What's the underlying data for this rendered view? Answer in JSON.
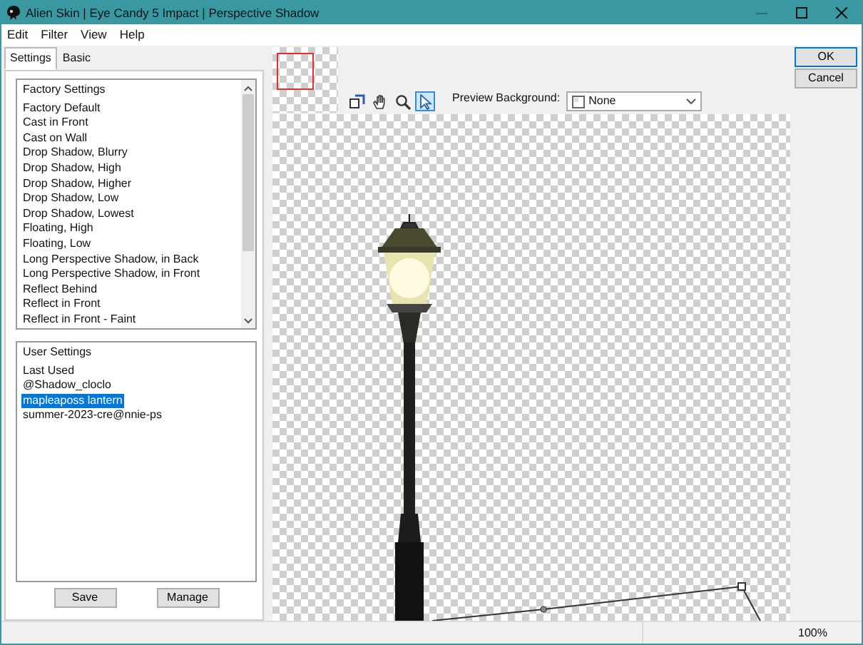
{
  "window": {
    "title": "Alien Skin | Eye Candy 5 Impact | Perspective Shadow"
  },
  "menu": [
    "Edit",
    "Filter",
    "View",
    "Help"
  ],
  "tabs": [
    {
      "label": "Settings",
      "selected": true
    },
    {
      "label": "Basic",
      "selected": false
    }
  ],
  "factory_settings": {
    "heading": "Factory Settings",
    "items": [
      "Factory Default",
      "Cast in Front",
      "Cast on Wall",
      "Drop Shadow, Blurry",
      "Drop Shadow, High",
      "Drop Shadow, Higher",
      "Drop Shadow, Low",
      "Drop Shadow, Lowest",
      "Floating, High",
      "Floating, Low",
      "Long Perspective Shadow, in Back",
      "Long Perspective Shadow, in Front",
      "Reflect Behind",
      "Reflect in Front",
      "Reflect in Front - Faint"
    ]
  },
  "user_settings": {
    "heading": "User Settings",
    "items": [
      {
        "label": "Last Used",
        "selected": false
      },
      {
        "label": "@Shadow_cloclo",
        "selected": false
      },
      {
        "label": "mapleaposs lantern",
        "selected": true
      },
      {
        "label": "summer-2023-cre@nnie-ps",
        "selected": false
      }
    ]
  },
  "settings_buttons": [
    "Save",
    "Manage"
  ],
  "tools": [
    {
      "kind": "navigate",
      "selected": false
    },
    {
      "kind": "hand",
      "selected": false
    },
    {
      "kind": "zoom",
      "selected": false
    },
    {
      "kind": "pointer",
      "selected": true
    }
  ],
  "preview_background": {
    "label": "Preview Background:",
    "value": "None"
  },
  "dialog_buttons": [
    "OK",
    "Cancel"
  ],
  "status_bar": {
    "zoom": "100%"
  }
}
